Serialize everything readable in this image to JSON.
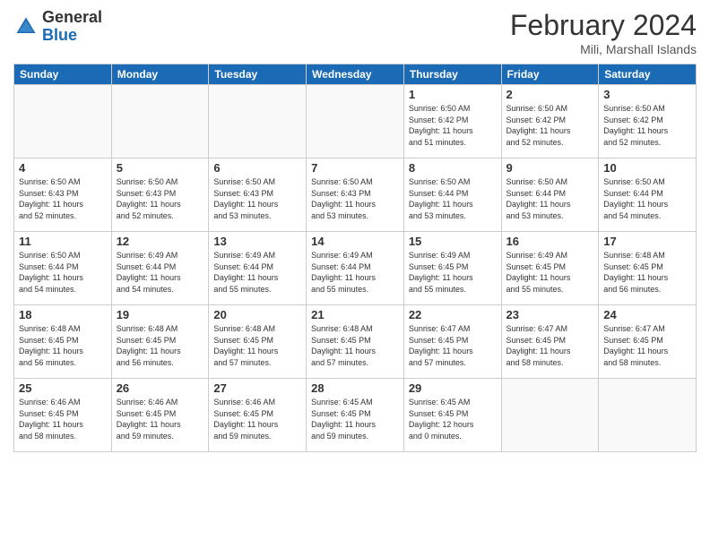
{
  "header": {
    "logo_general": "General",
    "logo_blue": "Blue",
    "month": "February 2024",
    "location": "Mili, Marshall Islands"
  },
  "days_of_week": [
    "Sunday",
    "Monday",
    "Tuesday",
    "Wednesday",
    "Thursday",
    "Friday",
    "Saturday"
  ],
  "weeks": [
    [
      {
        "day": "",
        "info": ""
      },
      {
        "day": "",
        "info": ""
      },
      {
        "day": "",
        "info": ""
      },
      {
        "day": "",
        "info": ""
      },
      {
        "day": "1",
        "info": "Sunrise: 6:50 AM\nSunset: 6:42 PM\nDaylight: 11 hours\nand 51 minutes."
      },
      {
        "day": "2",
        "info": "Sunrise: 6:50 AM\nSunset: 6:42 PM\nDaylight: 11 hours\nand 52 minutes."
      },
      {
        "day": "3",
        "info": "Sunrise: 6:50 AM\nSunset: 6:42 PM\nDaylight: 11 hours\nand 52 minutes."
      }
    ],
    [
      {
        "day": "4",
        "info": "Sunrise: 6:50 AM\nSunset: 6:43 PM\nDaylight: 11 hours\nand 52 minutes."
      },
      {
        "day": "5",
        "info": "Sunrise: 6:50 AM\nSunset: 6:43 PM\nDaylight: 11 hours\nand 52 minutes."
      },
      {
        "day": "6",
        "info": "Sunrise: 6:50 AM\nSunset: 6:43 PM\nDaylight: 11 hours\nand 53 minutes."
      },
      {
        "day": "7",
        "info": "Sunrise: 6:50 AM\nSunset: 6:43 PM\nDaylight: 11 hours\nand 53 minutes."
      },
      {
        "day": "8",
        "info": "Sunrise: 6:50 AM\nSunset: 6:44 PM\nDaylight: 11 hours\nand 53 minutes."
      },
      {
        "day": "9",
        "info": "Sunrise: 6:50 AM\nSunset: 6:44 PM\nDaylight: 11 hours\nand 53 minutes."
      },
      {
        "day": "10",
        "info": "Sunrise: 6:50 AM\nSunset: 6:44 PM\nDaylight: 11 hours\nand 54 minutes."
      }
    ],
    [
      {
        "day": "11",
        "info": "Sunrise: 6:50 AM\nSunset: 6:44 PM\nDaylight: 11 hours\nand 54 minutes."
      },
      {
        "day": "12",
        "info": "Sunrise: 6:49 AM\nSunset: 6:44 PM\nDaylight: 11 hours\nand 54 minutes."
      },
      {
        "day": "13",
        "info": "Sunrise: 6:49 AM\nSunset: 6:44 PM\nDaylight: 11 hours\nand 55 minutes."
      },
      {
        "day": "14",
        "info": "Sunrise: 6:49 AM\nSunset: 6:44 PM\nDaylight: 11 hours\nand 55 minutes."
      },
      {
        "day": "15",
        "info": "Sunrise: 6:49 AM\nSunset: 6:45 PM\nDaylight: 11 hours\nand 55 minutes."
      },
      {
        "day": "16",
        "info": "Sunrise: 6:49 AM\nSunset: 6:45 PM\nDaylight: 11 hours\nand 55 minutes."
      },
      {
        "day": "17",
        "info": "Sunrise: 6:48 AM\nSunset: 6:45 PM\nDaylight: 11 hours\nand 56 minutes."
      }
    ],
    [
      {
        "day": "18",
        "info": "Sunrise: 6:48 AM\nSunset: 6:45 PM\nDaylight: 11 hours\nand 56 minutes."
      },
      {
        "day": "19",
        "info": "Sunrise: 6:48 AM\nSunset: 6:45 PM\nDaylight: 11 hours\nand 56 minutes."
      },
      {
        "day": "20",
        "info": "Sunrise: 6:48 AM\nSunset: 6:45 PM\nDaylight: 11 hours\nand 57 minutes."
      },
      {
        "day": "21",
        "info": "Sunrise: 6:48 AM\nSunset: 6:45 PM\nDaylight: 11 hours\nand 57 minutes."
      },
      {
        "day": "22",
        "info": "Sunrise: 6:47 AM\nSunset: 6:45 PM\nDaylight: 11 hours\nand 57 minutes."
      },
      {
        "day": "23",
        "info": "Sunrise: 6:47 AM\nSunset: 6:45 PM\nDaylight: 11 hours\nand 58 minutes."
      },
      {
        "day": "24",
        "info": "Sunrise: 6:47 AM\nSunset: 6:45 PM\nDaylight: 11 hours\nand 58 minutes."
      }
    ],
    [
      {
        "day": "25",
        "info": "Sunrise: 6:46 AM\nSunset: 6:45 PM\nDaylight: 11 hours\nand 58 minutes."
      },
      {
        "day": "26",
        "info": "Sunrise: 6:46 AM\nSunset: 6:45 PM\nDaylight: 11 hours\nand 59 minutes."
      },
      {
        "day": "27",
        "info": "Sunrise: 6:46 AM\nSunset: 6:45 PM\nDaylight: 11 hours\nand 59 minutes."
      },
      {
        "day": "28",
        "info": "Sunrise: 6:45 AM\nSunset: 6:45 PM\nDaylight: 11 hours\nand 59 minutes."
      },
      {
        "day": "29",
        "info": "Sunrise: 6:45 AM\nSunset: 6:45 PM\nDaylight: 12 hours\nand 0 minutes."
      },
      {
        "day": "",
        "info": ""
      },
      {
        "day": "",
        "info": ""
      }
    ]
  ]
}
